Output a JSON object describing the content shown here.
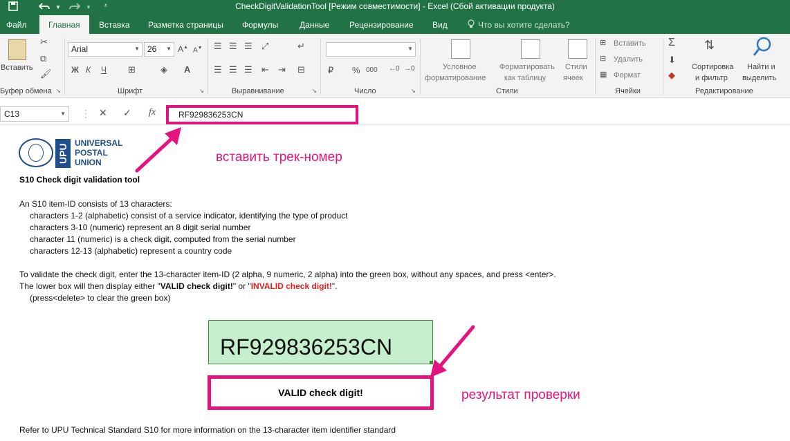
{
  "window": {
    "title": "CheckDigitValidationTool  [Режим совместимости] - Excel (Сбой активации продукта)"
  },
  "quick_access": {
    "save_icon": "save-icon",
    "undo_icon": "undo-icon",
    "redo_icon": "redo-icon",
    "customize_icon": "customize-icon"
  },
  "tabs": [
    {
      "label": "Файл"
    },
    {
      "label": "Главная"
    },
    {
      "label": "Вставка"
    },
    {
      "label": "Разметка страницы"
    },
    {
      "label": "Формулы"
    },
    {
      "label": "Данные"
    },
    {
      "label": "Рецензирование"
    },
    {
      "label": "Вид"
    },
    {
      "label": "Что вы хотите сделать?"
    }
  ],
  "ribbon": {
    "clipboard": {
      "paste_label": "Вставить",
      "group_label": "Буфер обмена"
    },
    "font": {
      "font_name": "Arial",
      "font_size": "26",
      "bold": "Ж",
      "italic": "К",
      "underline": "Ч",
      "group_label": "Шрифт"
    },
    "alignment": {
      "group_label": "Выравнивание"
    },
    "number": {
      "format_value": "",
      "percent": "%",
      "thousands": "000",
      "group_label": "Число"
    },
    "styles": {
      "conditional_line1": "Условное",
      "conditional_line2": "форматирование",
      "format_table_line1": "Форматировать",
      "format_table_line2": "как таблицу",
      "cell_styles_line1": "Стили",
      "cell_styles_line2": "ячеек",
      "group_label": "Стили"
    },
    "cells": {
      "insert": "Вставить",
      "delete": "Удалить",
      "format": "Формат",
      "group_label": "Ячейки"
    },
    "editing": {
      "sort_line1": "Сортировка",
      "sort_line2": "и фильтр",
      "find_line1": "Найти и",
      "find_line2": "выделить",
      "group_label": "Редактирование"
    }
  },
  "formula_bar": {
    "name_box": "C13",
    "cancel": "✕",
    "enter": "✓",
    "fx": "fx",
    "value": "RF929836253CN"
  },
  "sheet": {
    "logo": {
      "abbr": "UPU",
      "line1": "UNIVERSAL",
      "line2": "POSTAL",
      "line3": "UNION"
    },
    "annotation_insert": "вставить трек-номер",
    "annotation_result": "результат проверки",
    "title": "S10 Check digit validation tool",
    "intro": "An S10 item-ID consists of 13 characters:",
    "bullets": [
      "characters 1-2 (alphabetic) consist of a service indicator, identifying the type of product",
      "characters 3-10 (numeric) represent an 8 digit serial number",
      "character 11 (numeric) is a check digit, computed from the serial number",
      "characters 12-13 (alphabetic) represent a country code"
    ],
    "instruction": "To validate the check digit, enter the 13-character item-ID (2 alpha, 9 numeric, 2 alpha) into the green box, without any spaces, and press <enter>.",
    "lower_box_prefix": "The lower box will then display either \"",
    "valid_text": "VALID check digit!",
    "middle_text": "\" or \"",
    "invalid_text": "INVALID check digit!",
    "suffix_text": "\".",
    "press_delete": "(press<delete> to clear the green box)",
    "input_value": "RF929836253CN",
    "result": "VALID check digit!",
    "reference": "Refer to UPU Technical Standard S10 for more information on the 13-character item identifier standard"
  },
  "colors": {
    "excel_green": "#217346",
    "annotation_pink": "#e5137e",
    "input_green": "#c6efce",
    "invalid_red": "#e02020",
    "upu_blue": "#1f4e8c"
  }
}
